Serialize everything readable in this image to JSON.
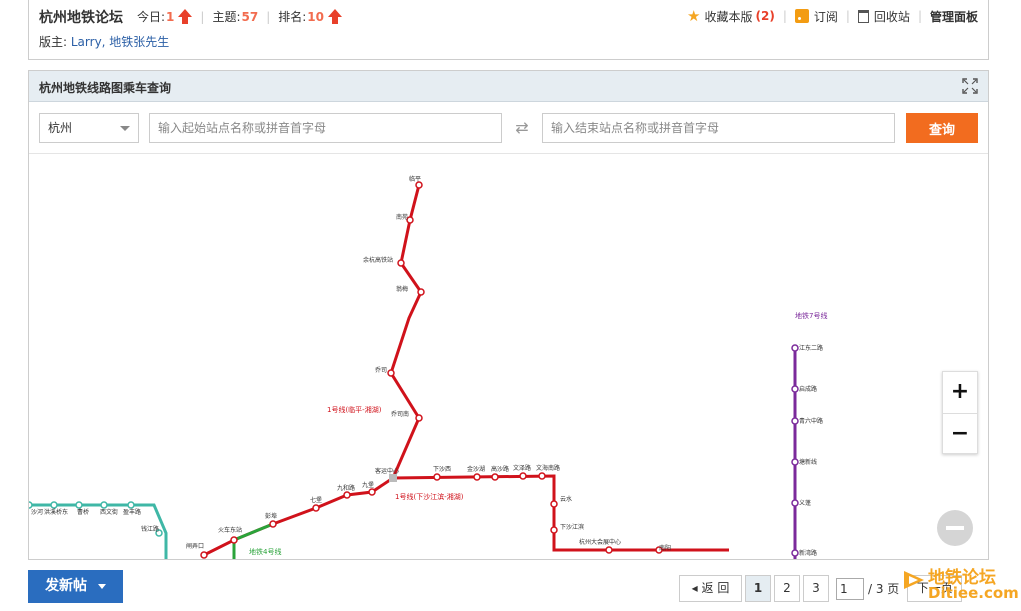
{
  "header": {
    "forum_title": "杭州地铁论坛",
    "today_label": "今日:",
    "today_value": "1",
    "topics_label": "主题:",
    "topics_value": "57",
    "rank_label": "排名:",
    "rank_value": "10",
    "moderator_label": "版主:",
    "moderators": "Larry, 地铁张先生",
    "favorite_label": "收藏本版",
    "favorite_count": "(2)",
    "subscribe_label": "订阅",
    "recycle_label": "回收站",
    "manage_label": "管理面板"
  },
  "panel": {
    "title": "杭州地铁线路图乘车查询",
    "city": "杭州",
    "start_placeholder": "输入起始站点名称或拼音首字母",
    "end_placeholder": "输入结束站点名称或拼音首字母",
    "query_label": "查询",
    "zoom_in": "+",
    "zoom_out": "−"
  },
  "map": {
    "line1_label_a": "1号线(临平-湘湖)",
    "line1_label_b": "1号线(下沙江滨-湘湖)",
    "line4_label": "地铁4号线",
    "line7_label": "地铁7号线",
    "colors": {
      "line1": "#d0121b",
      "line2": "#3fb7a6",
      "line4": "#2aa33a",
      "line7": "#7b2a9b"
    },
    "stations_line1_north": [
      "临平",
      "南苑",
      "余杭高铁站",
      "翁梅",
      "乔司",
      "乔司南",
      "客运中心"
    ],
    "stations_line1_east": [
      "下沙西",
      "金沙湖",
      "高沙路",
      "文泽路",
      "文海南路",
      "云水",
      "下沙江滨",
      "杭州大会展中心",
      "南阳"
    ],
    "stations_line1_west": [
      "九堡",
      "九和路",
      "七堡",
      "彭埠",
      "火车东站",
      "闸弄口"
    ],
    "stations_line7": [
      "江东二路",
      "启成路",
      "青六中路",
      "塘新线",
      "义蓬",
      "新湾路"
    ],
    "stations_line2": [
      "沙河",
      "洪溪桥东",
      "曹桥",
      "西文街",
      "盈丰路",
      "钱江路"
    ]
  },
  "footer": {
    "post_label": "发新帖",
    "back_label": "返 回",
    "pages": [
      "1",
      "2",
      "3"
    ],
    "current_page": "1",
    "total_pages": "/ 3 页",
    "next_label": "下一页"
  },
  "watermark": {
    "line1": "地铁论坛",
    "line2": "Ditiee.com"
  }
}
